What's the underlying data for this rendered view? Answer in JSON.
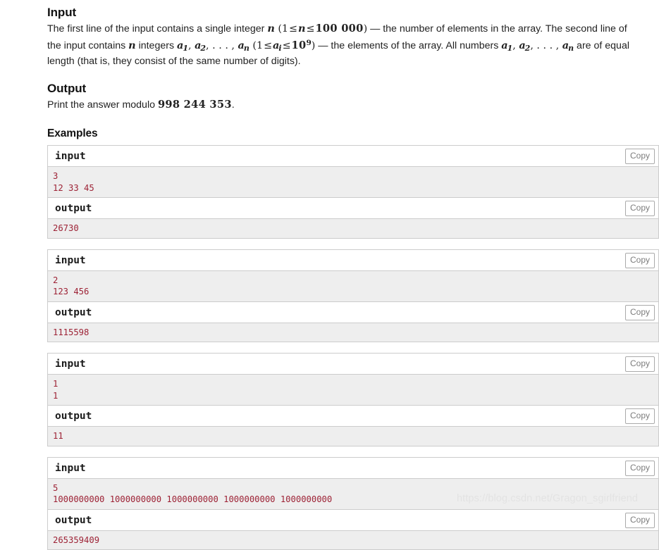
{
  "sections": {
    "input": {
      "heading": "Input",
      "paragraph_plain": "The first line of the input contains a single integer n (1 ≤ n ≤ 100 000) — the number of elements in the array. The second line of the input contains n integers a1, a2, …, an (1 ≤ ai ≤ 10^9) — the elements of the array. All numbers a1, a2, …, an are of equal length (that is, they consist of the same number of digits).",
      "parts": {
        "t1": "The first line of the input contains a single integer ",
        "var_n": "n",
        "paren_open": "(",
        "one": "1",
        "le": "≤",
        "limit_n": "100 000",
        "paren_close": ")",
        "t2": " — the number of elements in the array. The second line of the input contains ",
        "t3": " integers ",
        "a": "a",
        "sub1": "1",
        "sub2": "2",
        "comma": ", ",
        "dots": ". . . ,",
        "sub_n": "n",
        "sub_i": "i",
        "ten": "10",
        "sup9": "9",
        "t4": " — the elements of the array. All numbers ",
        "t5": " are of equal length (that is, they consist of the same number of digits)."
      }
    },
    "output": {
      "heading": "Output",
      "text_before": "Print the answer modulo ",
      "modulo": "998 244 353",
      "text_after": "."
    },
    "examples": {
      "heading": "Examples",
      "copy_label": "Copy",
      "input_label": "input",
      "output_label": "output",
      "tests": [
        {
          "input": "3\n12 33 45",
          "output": "26730"
        },
        {
          "input": "2\n123 456",
          "output": "1115598"
        },
        {
          "input": "1\n1",
          "output": "11"
        },
        {
          "input": "5\n1000000000 1000000000 1000000000 1000000000 1000000000",
          "output": "265359409"
        }
      ]
    }
  },
  "watermark": "https://blog.csdn.net/Gragon_sgirlfriend",
  "colors": {
    "data_text": "#9d2235",
    "data_bg": "#eeeeee",
    "border": "#cccccc",
    "copy_text": "#7c7c7c",
    "watermark": "#e3e3e3"
  }
}
